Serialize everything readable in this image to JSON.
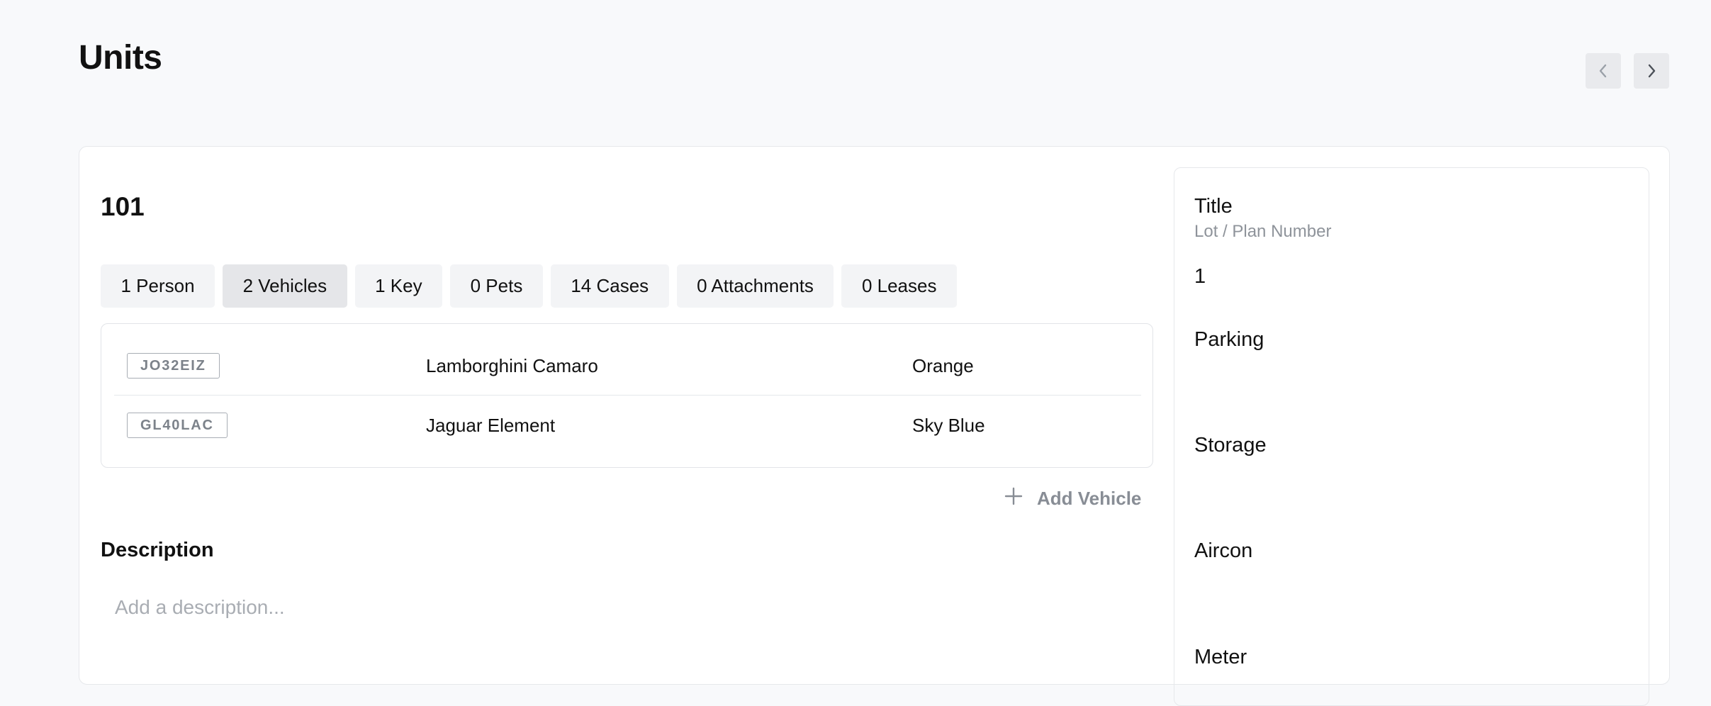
{
  "header": {
    "title": "Units",
    "prev_icon": "chevron-left-icon",
    "next_icon": "chevron-right-icon"
  },
  "unit": {
    "number": "101"
  },
  "tabs": [
    {
      "label": "1 Person",
      "active": false
    },
    {
      "label": "2 Vehicles",
      "active": true
    },
    {
      "label": "1 Key",
      "active": false
    },
    {
      "label": "0 Pets",
      "active": false
    },
    {
      "label": "14 Cases",
      "active": false
    },
    {
      "label": "0 Attachments",
      "active": false
    },
    {
      "label": "0 Leases",
      "active": false
    }
  ],
  "vehicles": [
    {
      "plate": "JO32EIZ",
      "model": "Lamborghini Camaro",
      "color": "Orange"
    },
    {
      "plate": "GL40LAC",
      "model": "Jaguar Element",
      "color": "Sky Blue"
    }
  ],
  "add_vehicle": {
    "label": "Add Vehicle",
    "icon": "plus-icon"
  },
  "description": {
    "label": "Description",
    "placeholder": "Add a description..."
  },
  "side_panel": {
    "title": {
      "label": "Title",
      "sublabel": "Lot / Plan Number",
      "value": "1"
    },
    "parking": {
      "label": "Parking",
      "value": ""
    },
    "storage": {
      "label": "Storage",
      "value": ""
    },
    "aircon": {
      "label": "Aircon",
      "value": ""
    },
    "meter": {
      "label": "Meter"
    }
  },
  "colors": {
    "background": "#f8f9fb",
    "card": "#ffffff",
    "tab": "#f3f4f6",
    "tab_active": "#e5e6e9",
    "muted_text": "#888d95"
  }
}
